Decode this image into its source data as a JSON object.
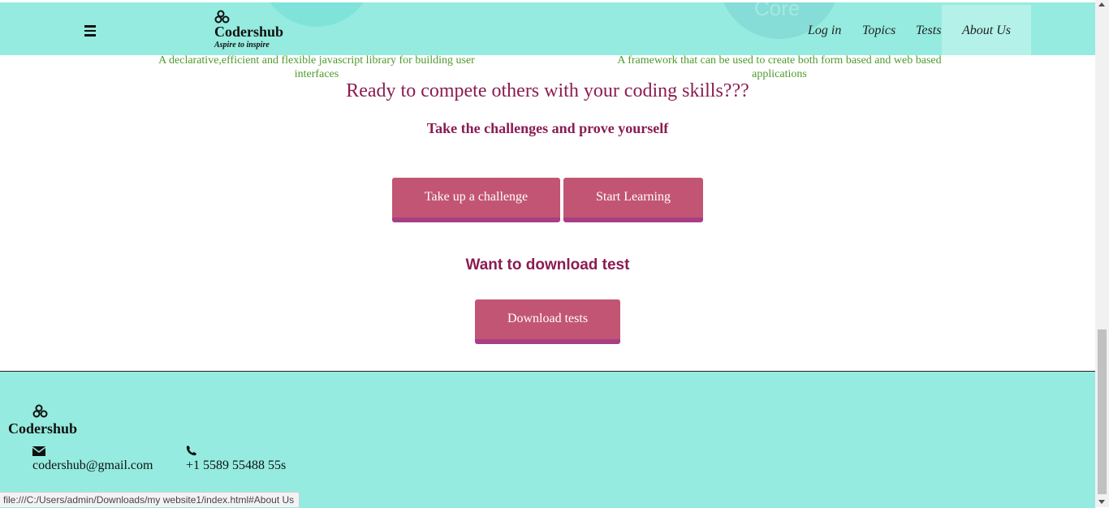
{
  "header": {
    "brand_name": "Codershub",
    "brand_tagline": "Aspire to inspire",
    "deco_text": "Core",
    "nav": {
      "login": "Log in",
      "topics": "Topics",
      "tests": "Tests",
      "about": "About Us"
    }
  },
  "cards": {
    "left_desc": "A declarative,efficient and flexible javascript library for building user interfaces",
    "right_desc": "A framework that can be used to create both form based and web based applications"
  },
  "main": {
    "headline": "Ready to compete others with your coding skills???",
    "subheadline": "Take the challenges and prove yourself",
    "challenge_button": "Take up a challenge",
    "learn_button": "Start Learning",
    "download_heading": "Want to download test",
    "download_button": "Download tests"
  },
  "footer": {
    "brand_name": "Codershub",
    "email": "codershub@gmail.com",
    "phone": "+1 5589 55488 55s"
  },
  "status_bar": {
    "url": "file:///C:/Users/admin/Downloads/my website1/index.html#About Us"
  },
  "colors": {
    "nav_bg": "#95ebdf",
    "accent_text": "#8b1c52",
    "button_bg": "#c25574",
    "button_border": "#a83e83",
    "card_text": "#4f9a2d"
  },
  "icons": [
    "menu-icon",
    "codershub-logo-icon",
    "envelope-icon",
    "phone-icon"
  ]
}
